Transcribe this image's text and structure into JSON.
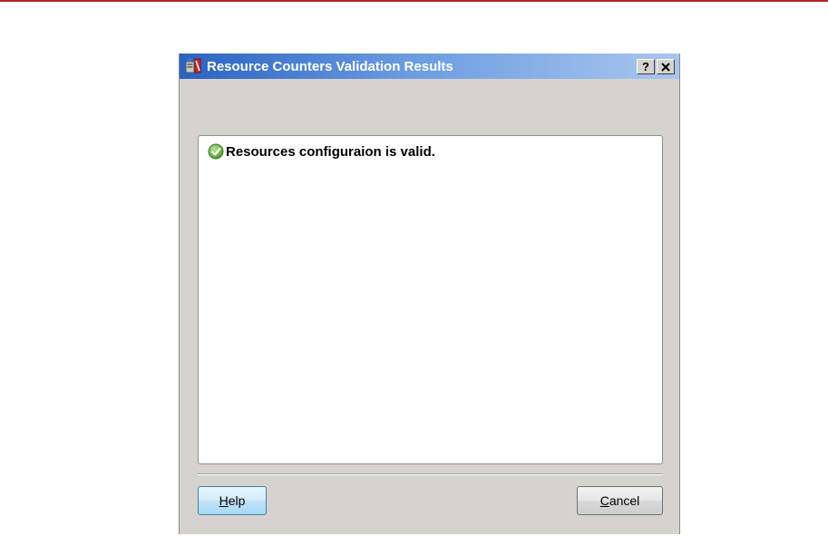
{
  "dialog": {
    "title": "Resource Counters Validation Results",
    "title_buttons": {
      "help": "?",
      "close": "✕"
    },
    "result": {
      "icon": "check-circle-icon",
      "message": "Resources configuraion is valid."
    },
    "buttons": {
      "help_label": "Help",
      "cancel_label": "Cancel"
    }
  },
  "colors": {
    "accent_rule": "#b5232a",
    "titlebar": "#2a62c0",
    "dialog_face": "#d6d3ce",
    "success_green": "#6ab04c"
  }
}
